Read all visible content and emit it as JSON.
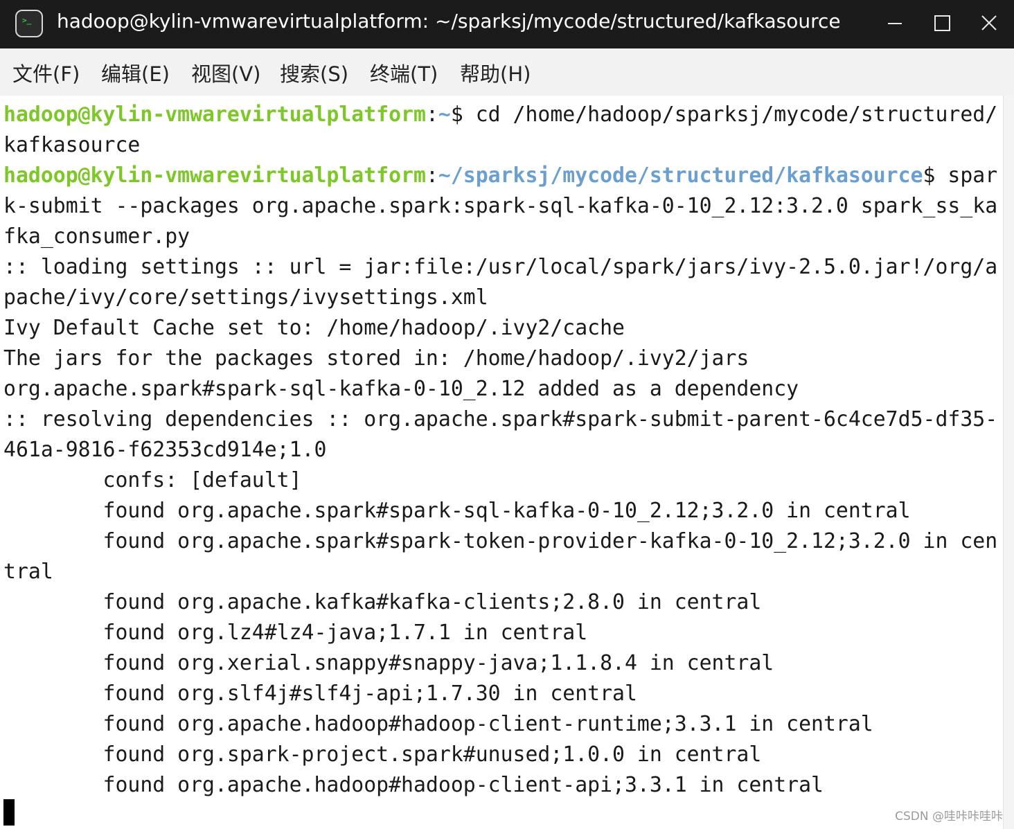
{
  "window": {
    "title": "hadoop@kylin-vmwarevirtualplatform: ~/sparksj/mycode/structured/kafkasource",
    "app_icon_glyph": ">_",
    "controls": [
      "minimize-icon",
      "maximize-icon",
      "close-icon"
    ]
  },
  "menu": {
    "items": [
      "文件(F)",
      "编辑(E)",
      "视图(V)",
      "搜索(S)",
      "终端(T)",
      "帮助(H)"
    ]
  },
  "terminal": {
    "colors": {
      "user_host": "#7dc828",
      "path": "#6b9fd0",
      "text": "#1a1a1a"
    },
    "prompt1": {
      "user_host": "hadoop@kylin-vmwarevirtualplatform",
      "sep": ":",
      "path": "~",
      "command": "$ cd /home/hadoop/sparksj/mycode/structured/"
    },
    "line2": "kafkasource",
    "prompt2": {
      "user_host": "hadoop@kylin-vmwarevirtualplatform",
      "sep": ":",
      "path": "~/sparksj/mycode/structured/kafkasource",
      "command": "$ spar"
    },
    "output": [
      "k-submit --packages org.apache.spark:spark-sql-kafka-0-10_2.12:3.2.0 spark_ss_ka",
      "fka_consumer.py",
      ":: loading settings :: url = jar:file:/usr/local/spark/jars/ivy-2.5.0.jar!/org/a",
      "pache/ivy/core/settings/ivysettings.xml",
      "Ivy Default Cache set to: /home/hadoop/.ivy2/cache",
      "The jars for the packages stored in: /home/hadoop/.ivy2/jars",
      "org.apache.spark#spark-sql-kafka-0-10_2.12 added as a dependency",
      ":: resolving dependencies :: org.apache.spark#spark-submit-parent-6c4ce7d5-df35-",
      "461a-9816-f62353cd914e;1.0",
      "        confs: [default]",
      "        found org.apache.spark#spark-sql-kafka-0-10_2.12;3.2.0 in central",
      "        found org.apache.spark#spark-token-provider-kafka-0-10_2.12;3.2.0 in cen",
      "tral",
      "        found org.apache.kafka#kafka-clients;2.8.0 in central",
      "        found org.lz4#lz4-java;1.7.1 in central",
      "        found org.xerial.snappy#snappy-java;1.1.8.4 in central",
      "        found org.slf4j#slf4j-api;1.7.30 in central",
      "        found org.apache.hadoop#hadoop-client-runtime;3.3.1 in central",
      "        found org.spark-project.spark#unused;1.0.0 in central",
      "        found org.apache.hadoop#hadoop-client-api;3.3.1 in central"
    ]
  },
  "watermark": "CSDN @哇咔咔哇咔"
}
